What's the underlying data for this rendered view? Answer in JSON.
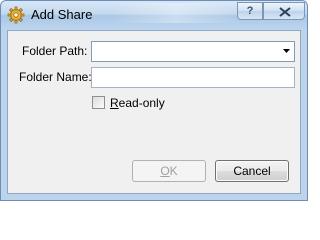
{
  "window": {
    "title": "Add Share",
    "help_label": "?"
  },
  "form": {
    "folder_path_label": "Folder Path:",
    "folder_path_value": "",
    "folder_name_label": "Folder Name:",
    "folder_name_value": "",
    "readonly_label": "Read-only",
    "readonly_checked": false
  },
  "buttons": {
    "ok_label": "OK",
    "ok_enabled": false,
    "cancel_label": "Cancel"
  },
  "icons": {
    "app": "gear-icon",
    "close": "close-icon",
    "dropdown": "chevron-down-icon"
  },
  "colors": {
    "titlebar": "#bcd3ea",
    "client_background": "#f0f0f0",
    "disabled_text": "#a0a0a0"
  }
}
